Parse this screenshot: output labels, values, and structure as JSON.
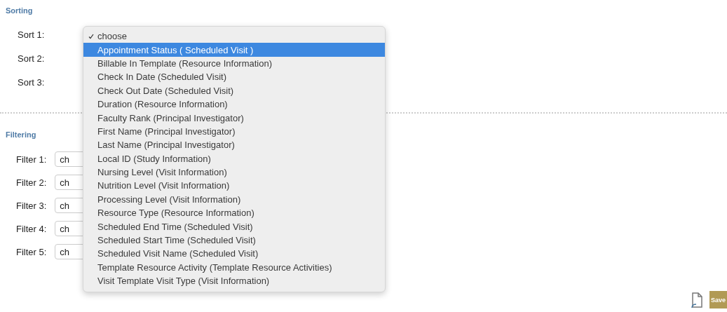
{
  "sorting": {
    "title": "Sorting",
    "rows": [
      {
        "label": "Sort 1:"
      },
      {
        "label": "Sort 2:"
      },
      {
        "label": "Sort 3:"
      }
    ]
  },
  "dropdown": {
    "items": [
      {
        "label": "choose",
        "checked": true,
        "highlighted": false
      },
      {
        "label": "Appointment Status ( Scheduled Visit )",
        "checked": false,
        "highlighted": true
      },
      {
        "label": "Billable In Template (Resource Information)",
        "checked": false,
        "highlighted": false
      },
      {
        "label": "Check In Date (Scheduled Visit)",
        "checked": false,
        "highlighted": false
      },
      {
        "label": "Check Out Date (Scheduled Visit)",
        "checked": false,
        "highlighted": false
      },
      {
        "label": "Duration (Resource Information)",
        "checked": false,
        "highlighted": false
      },
      {
        "label": "Faculty Rank (Principal Investigator)",
        "checked": false,
        "highlighted": false
      },
      {
        "label": "First Name (Principal Investigator)",
        "checked": false,
        "highlighted": false
      },
      {
        "label": "Last Name (Principal Investigator)",
        "checked": false,
        "highlighted": false
      },
      {
        "label": "Local ID (Study Information)",
        "checked": false,
        "highlighted": false
      },
      {
        "label": "Nursing Level (Visit Information)",
        "checked": false,
        "highlighted": false
      },
      {
        "label": "Nutrition Level (Visit Information)",
        "checked": false,
        "highlighted": false
      },
      {
        "label": "Processing Level (Visit Information)",
        "checked": false,
        "highlighted": false
      },
      {
        "label": "Resource Type (Resource Information)",
        "checked": false,
        "highlighted": false
      },
      {
        "label": "Scheduled End Time (Scheduled Visit)",
        "checked": false,
        "highlighted": false
      },
      {
        "label": "Scheduled Start Time (Scheduled Visit)",
        "checked": false,
        "highlighted": false
      },
      {
        "label": "Scheduled Visit Name (Scheduled Visit)",
        "checked": false,
        "highlighted": false
      },
      {
        "label": "Template Resource Activity (Template Resource Activities)",
        "checked": false,
        "highlighted": false
      },
      {
        "label": "Visit Template Visit Type (Visit Information)",
        "checked": false,
        "highlighted": false
      }
    ]
  },
  "filtering": {
    "title": "Filtering",
    "rows": [
      {
        "label": "Filter 1:",
        "value": "ch"
      },
      {
        "label": "Filter 2:",
        "value": "ch"
      },
      {
        "label": "Filter 3:",
        "value": "ch"
      },
      {
        "label": "Filter 4:",
        "value": "ch"
      },
      {
        "label": "Filter 5:",
        "value": "ch"
      }
    ]
  },
  "footer": {
    "save": "Save"
  }
}
